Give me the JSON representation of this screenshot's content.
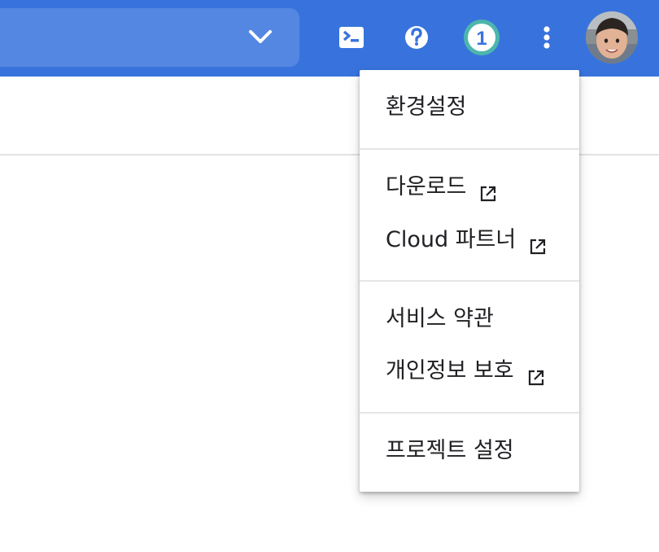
{
  "notification_count": "1",
  "menu": {
    "preferences": "환경설정",
    "downloads": "다운로드",
    "cloud_partners": "Cloud 파트너",
    "terms": "서비스 약관",
    "privacy": "개인정보 보호",
    "project_settings": "프로젝트 설정"
  },
  "colors": {
    "topbar": "#3873DD",
    "notification_ring": "#4DB6AC"
  },
  "icons": [
    "chevron-down-icon",
    "cloud-shell-icon",
    "help-icon",
    "notification-badge",
    "more-vert-icon",
    "open-in-new-icon"
  ]
}
